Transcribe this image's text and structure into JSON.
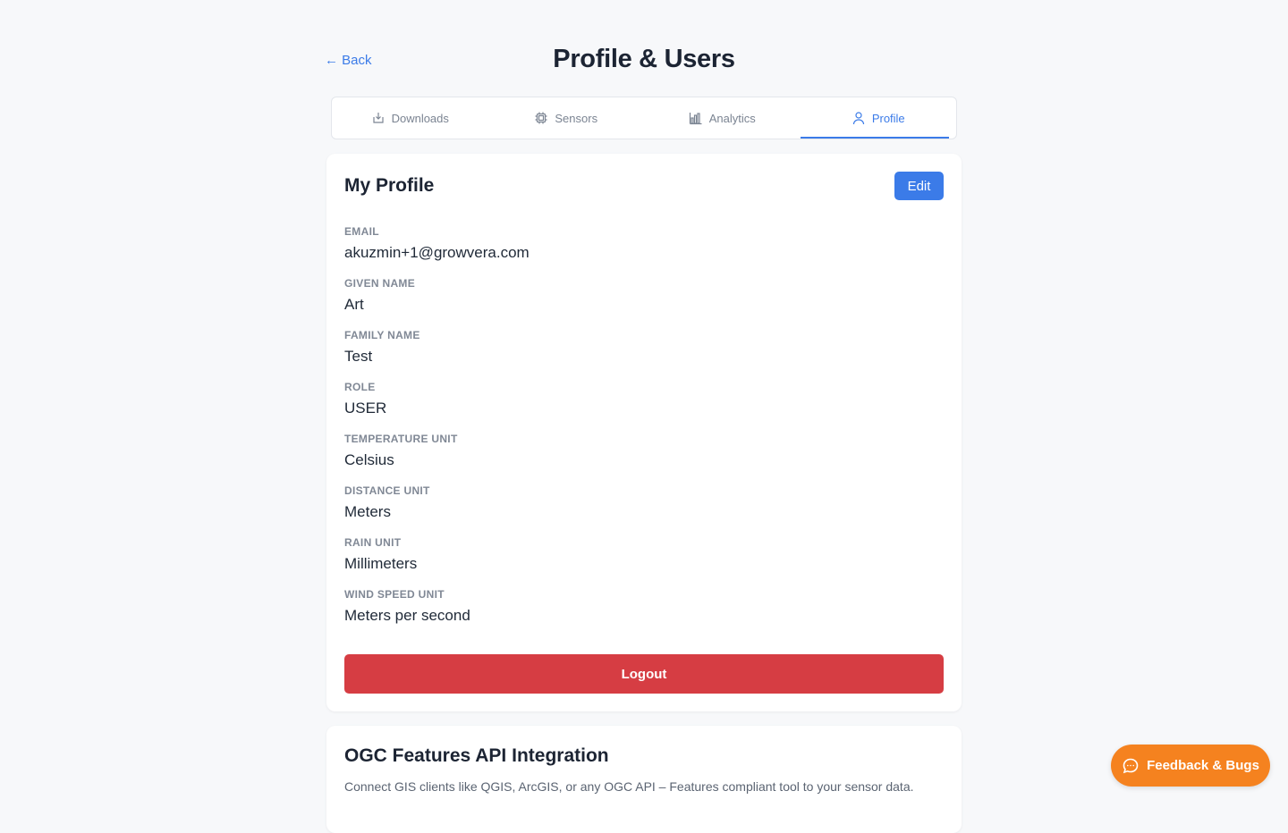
{
  "header": {
    "back_label": "← Back",
    "title": "Profile & Users"
  },
  "tabs": [
    {
      "label": "Downloads",
      "icon": "download-icon",
      "active": false
    },
    {
      "label": "Sensors",
      "icon": "chip-icon",
      "active": false
    },
    {
      "label": "Analytics",
      "icon": "bar-chart-icon",
      "active": false
    },
    {
      "label": "Profile",
      "icon": "user-icon",
      "active": true
    }
  ],
  "profile": {
    "title": "My Profile",
    "edit_label": "Edit",
    "fields": [
      {
        "label": "EMAIL",
        "value": "akuzmin+1@growvera.com"
      },
      {
        "label": "GIVEN NAME",
        "value": "Art"
      },
      {
        "label": "FAMILY NAME",
        "value": "Test"
      },
      {
        "label": "ROLE",
        "value": "USER"
      },
      {
        "label": "TEMPERATURE UNIT",
        "value": "Celsius"
      },
      {
        "label": "DISTANCE UNIT",
        "value": "Meters"
      },
      {
        "label": "RAIN UNIT",
        "value": "Millimeters"
      },
      {
        "label": "WIND SPEED UNIT",
        "value": "Meters per second"
      }
    ],
    "logout_label": "Logout"
  },
  "ogc": {
    "title": "OGC Features API Integration",
    "description": "Connect GIS clients like QGIS, ArcGIS, or any OGC API – Features compliant tool to your sensor data."
  },
  "feedback": {
    "label": "Feedback & Bugs",
    "icon": "chat-bubble-icon"
  },
  "colors": {
    "accent": "#3b7be8",
    "danger": "#d63d43",
    "feedback": "#f5821f",
    "background": "#f7f8fa"
  }
}
